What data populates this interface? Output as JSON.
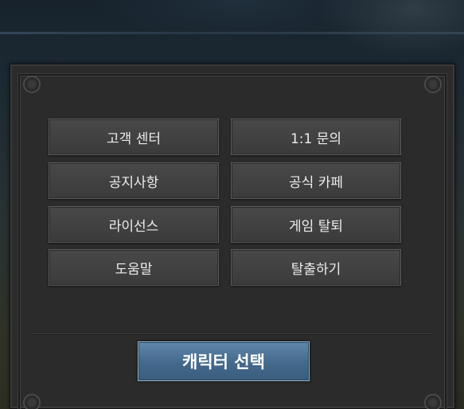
{
  "menu": {
    "items": [
      {
        "label": "고객 센터"
      },
      {
        "label": "1:1 문의"
      },
      {
        "label": "공지사항"
      },
      {
        "label": "공식 카페"
      },
      {
        "label": "라이선스"
      },
      {
        "label": "게임 탈퇴"
      },
      {
        "label": "도움말"
      },
      {
        "label": "탈출하기"
      }
    ]
  },
  "footer": {
    "character_select_label": "캐릭터 선택"
  },
  "colors": {
    "panel_bg": "#2b2b2b",
    "button_bg": "#444444",
    "accent_button": "#4b7294",
    "text": "#ececec"
  }
}
